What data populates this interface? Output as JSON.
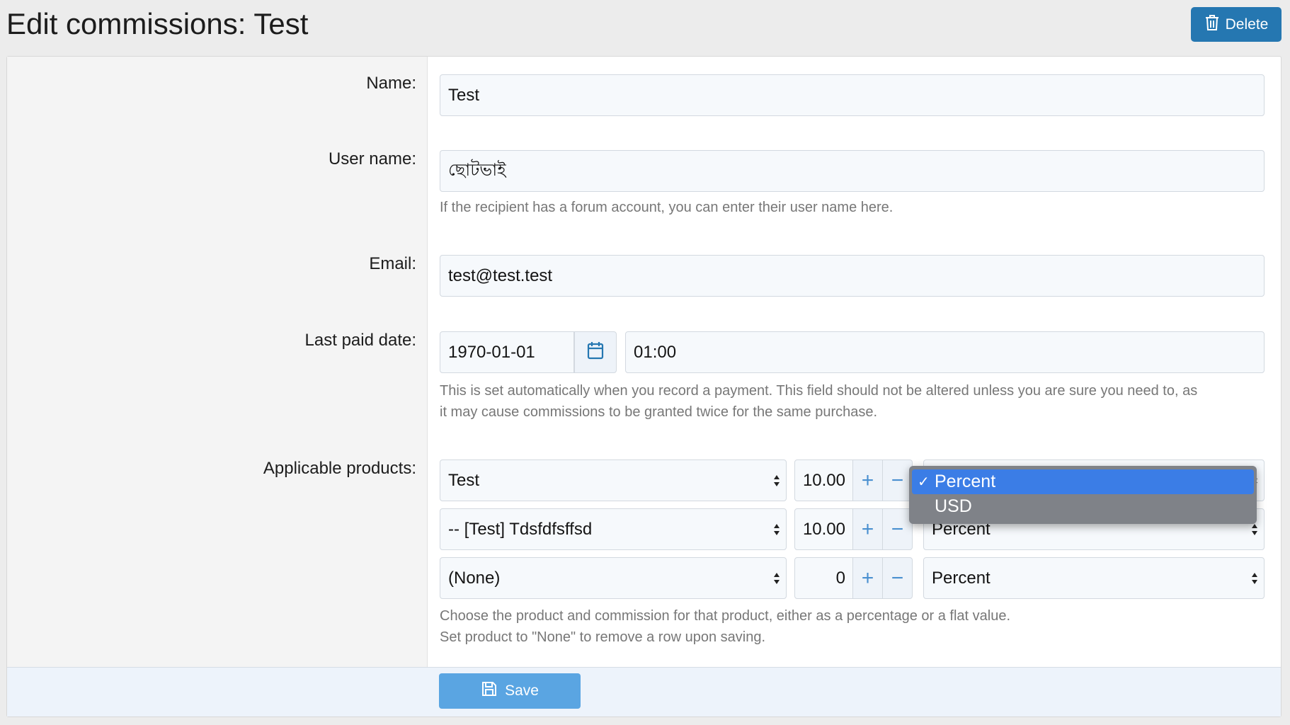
{
  "header": {
    "title": "Edit commissions: Test",
    "delete_label": "Delete"
  },
  "form": {
    "name": {
      "label": "Name:",
      "value": "Test"
    },
    "user_name": {
      "label": "User name:",
      "value": "ছোটভাই",
      "hint": "If the recipient has a forum account, you can enter their user name here."
    },
    "email": {
      "label": "Email:",
      "value": "test@test.test"
    },
    "last_paid": {
      "label": "Last paid date:",
      "date": "1970-01-01",
      "time": "01:00",
      "hint_line1": "This is set automatically when you record a payment. This field should not be altered unless you are sure you need to, as",
      "hint_line2": "it may cause commissions to be granted twice for the same purchase."
    },
    "products": {
      "label": "Applicable products:",
      "rows": [
        {
          "product": "Test",
          "amount": "10.00",
          "type": "Percent"
        },
        {
          "product": "-- [Test] Tdsfdfsffsd",
          "amount": "10.00",
          "type": "Percent"
        },
        {
          "product": "(None)",
          "amount": "0",
          "type": "Percent"
        }
      ],
      "hint_line1": "Choose the product and commission for that product, either as a percentage or a flat value.",
      "hint_line2": "Set product to \"None\" to remove a row upon saving."
    },
    "type_dropdown": {
      "options": [
        "Percent",
        "USD"
      ],
      "selected": "Percent",
      "check": "✓"
    }
  },
  "footer": {
    "save_label": "Save"
  },
  "colors": {
    "primary": "#2577b1",
    "save": "#5aa5e2",
    "dropdown_highlight": "#3b7de6"
  }
}
